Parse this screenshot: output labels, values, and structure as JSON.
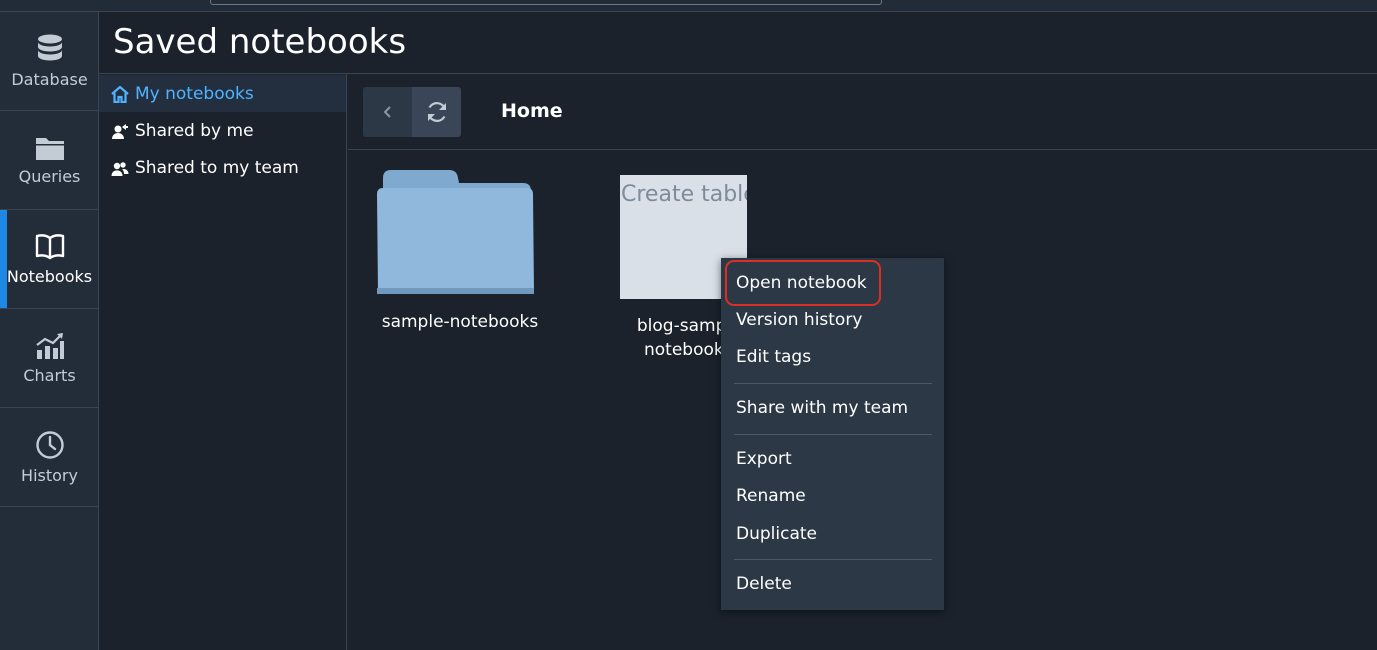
{
  "rail": {
    "items": [
      {
        "label": "Database",
        "icon": "database-icon"
      },
      {
        "label": "Queries",
        "icon": "folder-icon"
      },
      {
        "label": "Notebooks",
        "icon": "book-icon"
      },
      {
        "label": "Charts",
        "icon": "chart-icon"
      },
      {
        "label": "History",
        "icon": "clock-icon"
      }
    ],
    "active": "Notebooks"
  },
  "header": {
    "title": "Saved notebooks"
  },
  "subnav": {
    "items": [
      {
        "label": "My notebooks",
        "icon": "home-icon"
      },
      {
        "label": "Shared by me",
        "icon": "share-user-icon"
      },
      {
        "label": "Shared to my team",
        "icon": "team-icon"
      }
    ],
    "active": "My notebooks"
  },
  "toolbar": {
    "breadcrumb": "Home"
  },
  "files": [
    {
      "type": "folder",
      "name": "sample-notebooks"
    },
    {
      "type": "notebook",
      "name_line1": "blog-sampl",
      "name_line2": "notebook",
      "preview_text": "Create table"
    }
  ],
  "context_menu": {
    "groups": [
      [
        "Open notebook",
        "Version history",
        "Edit tags"
      ],
      [
        "Share with my team"
      ],
      [
        "Export",
        "Rename",
        "Duplicate"
      ],
      [
        "Delete"
      ]
    ],
    "highlighted": "Open notebook"
  },
  "colors": {
    "background": "#1b222c",
    "rail": "#232d3a",
    "accent": "#1e88e5",
    "link": "#4fb3ff",
    "menu": "#2c3846",
    "highlight_ring": "#d93025",
    "folder": "#8fb8dc"
  }
}
